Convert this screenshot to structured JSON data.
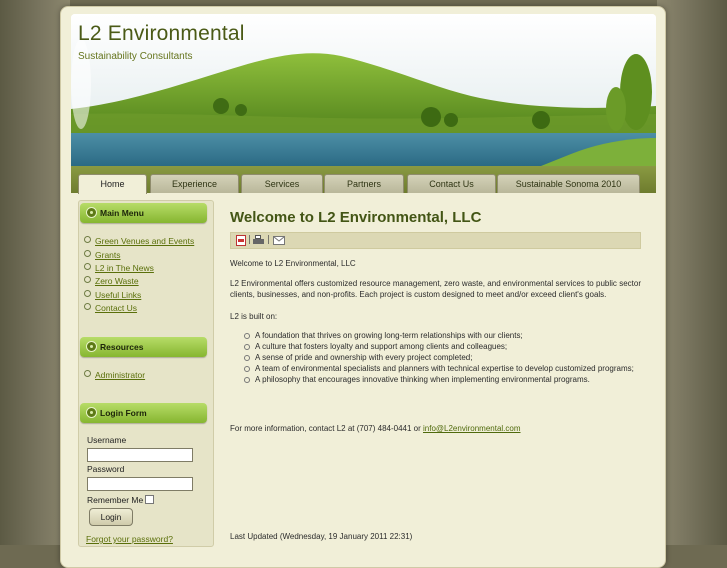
{
  "site": {
    "title": "L2 Environmental",
    "subtitle": "Sustainability Consultants"
  },
  "nav": {
    "tabs": [
      {
        "label": "Home",
        "active": true
      },
      {
        "label": "Experience"
      },
      {
        "label": "Services"
      },
      {
        "label": "Partners"
      },
      {
        "label": "Contact Us"
      },
      {
        "label": "Sustainable Sonoma 2010"
      }
    ]
  },
  "sidebar": {
    "main_menu": {
      "title": "Main Menu",
      "items": [
        "Green Venues and Events",
        "Grants",
        "L2 in The News",
        "Zero Waste",
        "Useful Links",
        "Contact Us"
      ]
    },
    "resources": {
      "title": "Resources",
      "items": [
        "Administrator"
      ]
    },
    "login": {
      "title": "Login Form",
      "username_label": "Username",
      "password_label": "Password",
      "remember_label": "Remember Me",
      "button_label": "Login",
      "forgot_label": "Forgot your password?"
    }
  },
  "article": {
    "title": "Welcome to L2 Environmental, LLC",
    "icons": [
      "pdf-icon",
      "print-icon",
      "email-icon"
    ],
    "intro": "Welcome to L2 Environmental, LLC",
    "body": "L2 Environmental offers customized resource management, zero waste, and environmental services to public sector clients, businesses, and non-profits.  Each project is custom designed to meet and/or exceed client's goals.",
    "built_on": "L2 is built on:",
    "bullets": [
      "A foundation that thrives on growing long-term relationships with our clients;",
      "A culture that fosters loyalty and support among clients and colleagues;",
      "A sense of pride and ownership with every project completed;",
      "A team of environmental specialists and planners with technical expertise to develop customized programs;",
      "A philosophy that encourages innovative thinking when implementing environmental programs."
    ],
    "contact_prefix": "For more information, contact L2 at (707) 484-0441 or ",
    "contact_email": "info@L2environmental.com",
    "last_updated": "Last Updated (Wednesday, 19 January 2011 22:31)"
  },
  "colors": {
    "accent": "#86b630",
    "title": "#4a5a16",
    "link": "#5a6f0a",
    "nav_bar": "#7a8a36"
  }
}
